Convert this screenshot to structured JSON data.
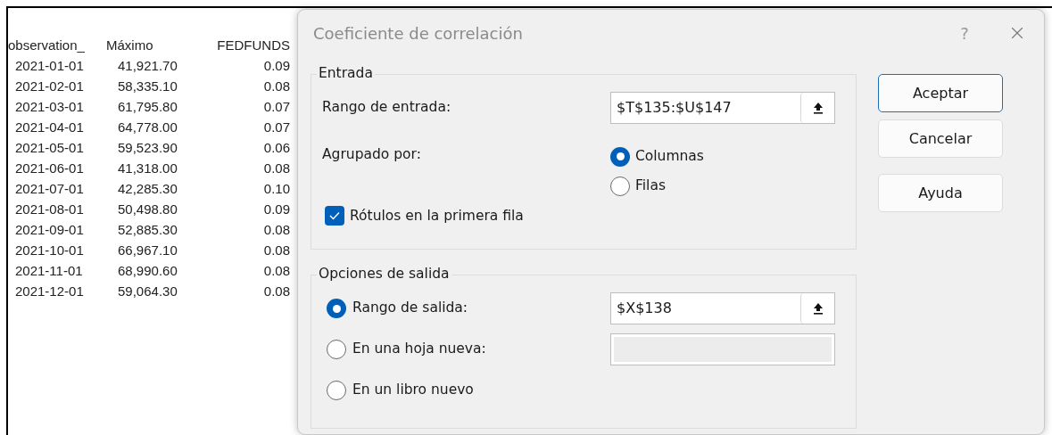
{
  "spreadsheet": {
    "columns": [
      "observation_",
      "Máximo",
      "FEDFUNDS"
    ],
    "rows": [
      [
        "2021-01-01",
        "41,921.70",
        "0.09"
      ],
      [
        "2021-02-01",
        "58,335.10",
        "0.08"
      ],
      [
        "2021-03-01",
        "61,795.80",
        "0.07"
      ],
      [
        "2021-04-01",
        "64,778.00",
        "0.07"
      ],
      [
        "2021-05-01",
        "59,523.90",
        "0.06"
      ],
      [
        "2021-06-01",
        "41,318.00",
        "0.08"
      ],
      [
        "2021-07-01",
        "42,285.30",
        "0.10"
      ],
      [
        "2021-08-01",
        "50,498.80",
        "0.09"
      ],
      [
        "2021-09-01",
        "52,885.30",
        "0.08"
      ],
      [
        "2021-10-01",
        "66,967.10",
        "0.08"
      ],
      [
        "2021-11-01",
        "68,990.60",
        "0.08"
      ],
      [
        "2021-12-01",
        "59,064.30",
        "0.08"
      ]
    ]
  },
  "dialog": {
    "title": "Coeficiente de correlación",
    "help": "?",
    "input_group": {
      "title": "Entrada",
      "range_label": "Rango de entrada:",
      "range_value": "$T$135:$U$147",
      "grouped_label": "Agrupado por:",
      "grouping_options": [
        {
          "label": "Columnas",
          "selected": true
        },
        {
          "label": "Filas",
          "selected": false
        }
      ],
      "labels_checkbox": {
        "label": "Rótulos en la primera fila",
        "checked": true
      }
    },
    "output_group": {
      "title": "Opciones de salida",
      "options": [
        {
          "kind": "range",
          "label": "Rango de salida:",
          "selected": true,
          "value": "$X$138"
        },
        {
          "kind": "sheet",
          "label": "En una hoja nueva:",
          "selected": false,
          "disabled": true
        },
        {
          "kind": "book",
          "label": "En un libro nuevo",
          "selected": false
        }
      ]
    },
    "buttons": [
      {
        "label": "Aceptar",
        "default": true
      },
      {
        "label": "Cancelar",
        "default": false
      },
      {
        "label": "Ayuda",
        "default": false
      }
    ]
  }
}
